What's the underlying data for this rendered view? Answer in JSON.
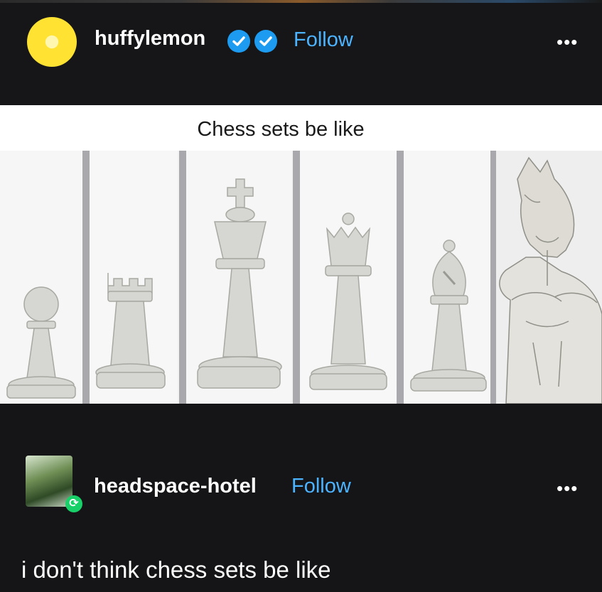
{
  "post": {
    "author": "huffylemon",
    "follow_label": "Follow",
    "more_label": "•••",
    "badges": [
      "verified-check-icon",
      "verified-check-icon"
    ],
    "meme_caption": "Chess sets be like",
    "pieces": [
      "pawn",
      "rook",
      "king",
      "queen",
      "bishop",
      "muscular-horse-knight"
    ]
  },
  "reply": {
    "author": "headspace-hotel",
    "follow_label": "Follow",
    "more_label": "•••",
    "reblog_icon": "reblog-icon",
    "text": "i don't think chess sets be like"
  },
  "colors": {
    "background": "#161618",
    "follow_blue": "#4cb3ff",
    "verified_blue": "#1d9bf0",
    "reblog_green": "#18d068"
  }
}
